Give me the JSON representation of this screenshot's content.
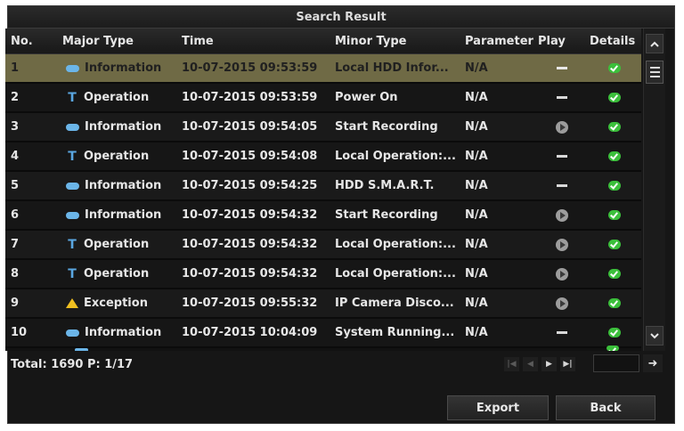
{
  "window": {
    "title": "Search Result"
  },
  "columns": {
    "no": "No.",
    "major_type": "Major Type",
    "time": "Time",
    "minor_type": "Minor Type",
    "parameter": "Parameter",
    "play": "Play",
    "details": "Details"
  },
  "rows": [
    {
      "no": "1",
      "major_type": "Information",
      "major_icon": "info-icon",
      "time": "10-07-2015 09:53:59",
      "minor_type": "Local HDD Infor...",
      "parameter": "N/A",
      "play": "dash",
      "details": "ok",
      "selected": true
    },
    {
      "no": "2",
      "major_type": "Operation",
      "major_icon": "operation-icon",
      "time": "10-07-2015 09:53:59",
      "minor_type": "Power On",
      "parameter": "N/A",
      "play": "dash",
      "details": "ok",
      "selected": false
    },
    {
      "no": "3",
      "major_type": "Information",
      "major_icon": "info-icon",
      "time": "10-07-2015 09:54:05",
      "minor_type": "Start Recording",
      "parameter": "N/A",
      "play": "play",
      "details": "ok",
      "selected": false
    },
    {
      "no": "4",
      "major_type": "Operation",
      "major_icon": "operation-icon",
      "time": "10-07-2015 09:54:08",
      "minor_type": "Local Operation:...",
      "parameter": "N/A",
      "play": "dash",
      "details": "ok",
      "selected": false
    },
    {
      "no": "5",
      "major_type": "Information",
      "major_icon": "info-icon",
      "time": "10-07-2015 09:54:25",
      "minor_type": "HDD S.M.A.R.T.",
      "parameter": "N/A",
      "play": "dash",
      "details": "ok",
      "selected": false
    },
    {
      "no": "6",
      "major_type": "Information",
      "major_icon": "info-icon",
      "time": "10-07-2015 09:54:32",
      "minor_type": "Start Recording",
      "parameter": "N/A",
      "play": "play",
      "details": "ok",
      "selected": false
    },
    {
      "no": "7",
      "major_type": "Operation",
      "major_icon": "operation-icon",
      "time": "10-07-2015 09:54:32",
      "minor_type": "Local Operation:...",
      "parameter": "N/A",
      "play": "play",
      "details": "ok",
      "selected": false
    },
    {
      "no": "8",
      "major_type": "Operation",
      "major_icon": "operation-icon",
      "time": "10-07-2015 09:54:32",
      "minor_type": "Local Operation:...",
      "parameter": "N/A",
      "play": "play",
      "details": "ok",
      "selected": false
    },
    {
      "no": "9",
      "major_type": "Exception",
      "major_icon": "exception-icon",
      "time": "10-07-2015 09:55:32",
      "minor_type": "IP Camera Disco...",
      "parameter": "N/A",
      "play": "play",
      "details": "ok",
      "selected": false
    },
    {
      "no": "10",
      "major_type": "Information",
      "major_icon": "info-icon",
      "time": "10-07-2015 10:04:09",
      "minor_type": "System Running...",
      "parameter": "N/A",
      "play": "dash",
      "details": "ok",
      "selected": false
    }
  ],
  "footer": {
    "total": "Total: 1690  P: 1/17"
  },
  "buttons": {
    "export": "Export",
    "back": "Back"
  },
  "colors": {
    "selected_row": "#6f6a45",
    "info_icon": "#6bb5e8",
    "exception_icon": "#f0c020",
    "ok_icon": "#3bbf3b"
  }
}
